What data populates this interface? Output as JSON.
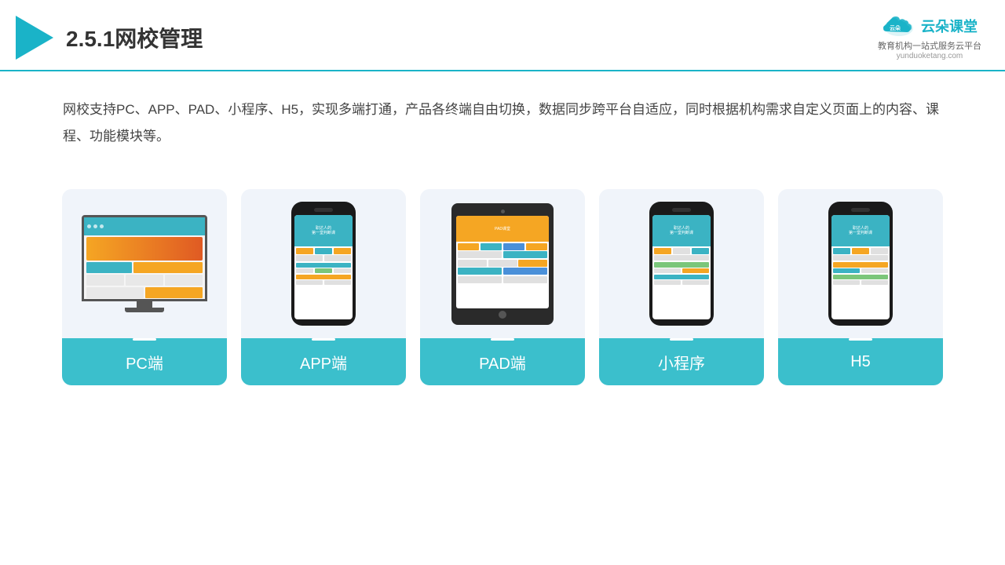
{
  "header": {
    "title": "2.5.1网校管理",
    "brand": {
      "name": "云朵课堂",
      "url": "yunduoketang.com",
      "tagline": "教育机构一站式服务云平台"
    }
  },
  "description": "网校支持PC、APP、PAD、小程序、H5，实现多端打通，产品各终端自由切换，数据同步跨平台自适应，同时根据机构需求自定义页面上的内容、课程、功能模块等。",
  "cards": [
    {
      "id": "pc",
      "label": "PC端"
    },
    {
      "id": "app",
      "label": "APP端"
    },
    {
      "id": "pad",
      "label": "PAD端"
    },
    {
      "id": "miniprogram",
      "label": "小程序"
    },
    {
      "id": "h5",
      "label": "H5"
    }
  ]
}
